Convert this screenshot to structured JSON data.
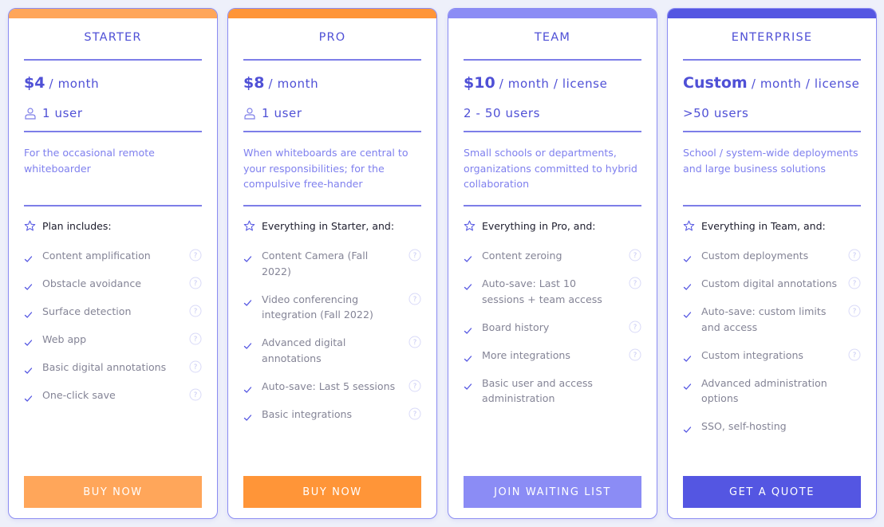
{
  "colors": {
    "background": "#eef0fa",
    "accent": "#4f50d6",
    "border": "#8b8cf2",
    "description": "#7f80ee",
    "feature_text": "#848496"
  },
  "plans": [
    {
      "name": "STARTER",
      "price_amount": "$4",
      "price_period": "/ month",
      "show_user_icon": true,
      "users": "1 user",
      "description": "For the occasional remote whiteboarder",
      "features_heading": "Plan includes:",
      "features": [
        {
          "label": "Content amplification",
          "help": true
        },
        {
          "label": "Obstacle avoidance",
          "help": true
        },
        {
          "label": "Surface detection",
          "help": true
        },
        {
          "label": "Web app",
          "help": true
        },
        {
          "label": "Basic digital annotations",
          "help": true
        },
        {
          "label": "One-click save",
          "help": true
        }
      ],
      "button_label": "BUY NOW",
      "strip_color": "#ffa65a",
      "button_color": "#ffa65a"
    },
    {
      "name": "PRO",
      "price_amount": "$8",
      "price_period": "/ month",
      "show_user_icon": true,
      "users": "1 user",
      "description": "When whiteboards are central to your responsibilities; for the compulsive free-hander",
      "features_heading": "Everything in Starter, and:",
      "features": [
        {
          "label": "Content Camera (Fall 2022)",
          "help": true
        },
        {
          "label": "Video conferencing integration (Fall 2022)",
          "help": true
        },
        {
          "label": "Advanced digital annotations",
          "help": true
        },
        {
          "label": "Auto-save: Last 5 sessions",
          "help": true
        },
        {
          "label": "Basic integrations",
          "help": true
        }
      ],
      "button_label": "BUY NOW",
      "strip_color": "#ff9538",
      "button_color": "#ff9538"
    },
    {
      "name": "TEAM",
      "price_amount": "$10",
      "price_period": "/ month / license",
      "show_user_icon": false,
      "users": "2 - 50 users",
      "description": "Small schools or departments, organizations committed to hybrid collaboration",
      "features_heading": "Everything in Pro, and:",
      "features": [
        {
          "label": "Content zeroing",
          "help": true
        },
        {
          "label": "Auto-save: Last 10 sessions + team access",
          "help": true
        },
        {
          "label": "Board history",
          "help": true
        },
        {
          "label": "More integrations",
          "help": true
        },
        {
          "label": "Basic user and access administration",
          "help": false
        }
      ],
      "button_label": "JOIN WAITING LIST",
      "strip_color": "#8b8cf5",
      "button_color": "#8b8cf5"
    },
    {
      "name": "ENTERPRISE",
      "price_amount": "Custom",
      "price_period": "/ month / license",
      "show_user_icon": false,
      "users": ">50 users",
      "description": "School / system-wide deployments and large business solutions",
      "features_heading": "Everything in Team, and:",
      "features": [
        {
          "label": "Custom deployments",
          "help": true
        },
        {
          "label": "Custom digital annotations",
          "help": true
        },
        {
          "label": "Auto-save: custom limits and access",
          "help": true
        },
        {
          "label": "Custom integrations",
          "help": true
        },
        {
          "label": "Advanced administration options",
          "help": false
        },
        {
          "label": "SSO, self-hosting",
          "help": false
        }
      ],
      "button_label": "GET A QUOTE",
      "strip_color": "#5456e2",
      "button_color": "#5456e2"
    }
  ]
}
